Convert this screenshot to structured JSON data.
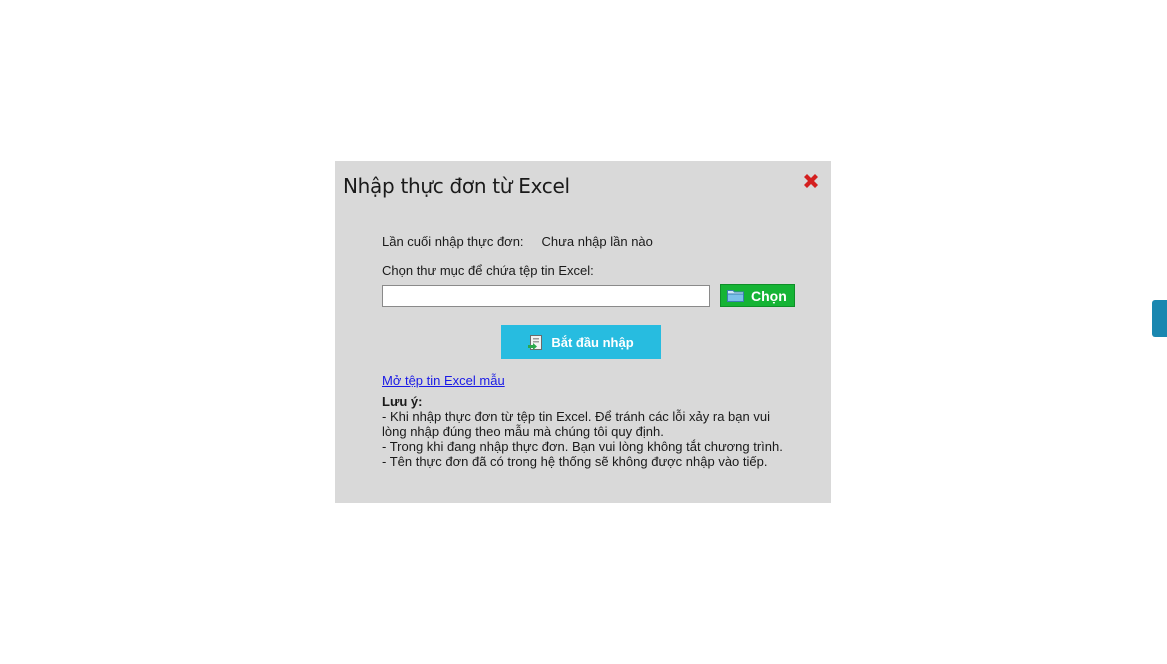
{
  "dialog": {
    "title": "Nhập thực đơn từ Excel",
    "close_icon": "close-icon"
  },
  "last_import": {
    "label": "Lần cuối nhập thực đơn:",
    "value": "Chưa nhập lần nào"
  },
  "folder": {
    "label": "Chọn thư mục để chứa tệp tin Excel:",
    "input_value": "",
    "choose_label": "Chọn",
    "choose_icon": "folder-icon"
  },
  "start_button": {
    "label": "Bắt đầu nhập",
    "icon": "import-icon"
  },
  "template_link": "Mở tệp tin Excel mẫu",
  "notes": {
    "title": "Lưu ý:",
    "lines": [
      "- Khi nhập thực đơn từ tệp tin Excel. Để tránh các lỗi xảy ra bạn vui",
      "lòng nhập đúng theo mẫu mà chúng tôi quy định.",
      "- Trong khi đang nhập thực đơn. Bạn vui lòng không tắt chương trình.",
      "- Tên thực đơn đã có trong hệ thống sẽ không được nhập vào tiếp."
    ]
  },
  "colors": {
    "dialog_bg": "#d9d9d9",
    "choose_button": "#15b435",
    "start_button": "#27bce0",
    "close_icon": "#d42020",
    "link": "#1a1ae6",
    "side_tab": "#1a87b0"
  }
}
